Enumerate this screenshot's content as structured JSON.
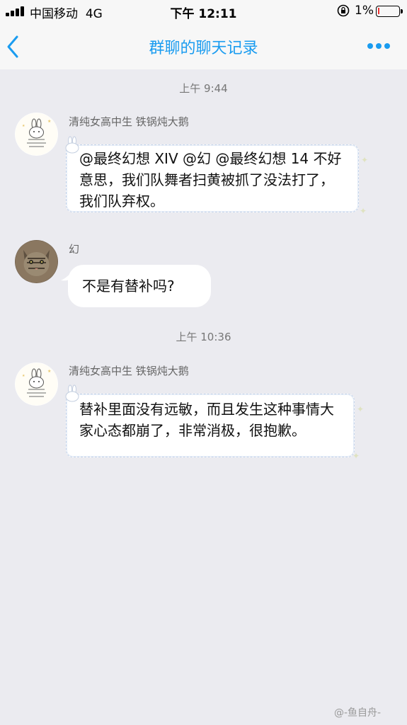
{
  "status_bar": {
    "carrier": "中国移动",
    "network": "4G",
    "time": "下午 12:11",
    "battery_percent": "1%",
    "battery_level": 0.01
  },
  "nav": {
    "title": "群聊的聊天记录",
    "accent_color": "#1a9cf0"
  },
  "messages": [
    {
      "timestamp": "上午 9:44",
      "sender": "清纯女高中生 铁锅炖大鹅",
      "text": "@最终幻想 XIV @幻 @最终幻想 14 不好意思，我们队舞者扫黄被抓了没法打了，我们队弃权。"
    },
    {
      "sender": "幻",
      "text": "不是有替补吗?"
    },
    {
      "timestamp": "上午 10:36",
      "sender": "清纯女高中生 铁锅炖大鹅",
      "text": "替补里面没有远敏，而且发生这种事情大家心态都崩了，非常消极，很抱歉。"
    }
  ],
  "watermark": "@-鱼自舟-"
}
